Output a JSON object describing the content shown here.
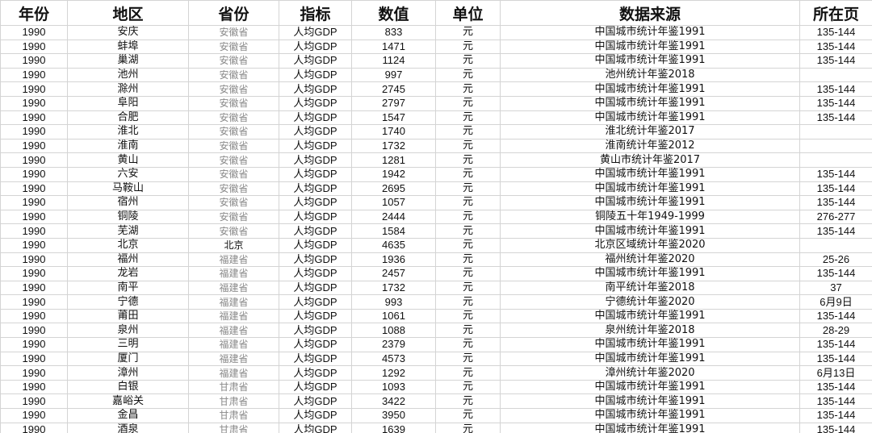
{
  "headers": [
    "年份",
    "地区",
    "省份",
    "指标",
    "数值",
    "单位",
    "数据来源",
    "所在页"
  ],
  "rows": [
    {
      "year": "1990",
      "region": "安庆",
      "province": "安徽省",
      "indicator": "人均GDP",
      "value": "833",
      "unit": "元",
      "source": "中国城市统计年鉴1991",
      "page": "135-144"
    },
    {
      "year": "1990",
      "region": "蚌埠",
      "province": "安徽省",
      "indicator": "人均GDP",
      "value": "1471",
      "unit": "元",
      "source": "中国城市统计年鉴1991",
      "page": "135-144"
    },
    {
      "year": "1990",
      "region": "巢湖",
      "province": "安徽省",
      "indicator": "人均GDP",
      "value": "1124",
      "unit": "元",
      "source": "中国城市统计年鉴1991",
      "page": "135-144"
    },
    {
      "year": "1990",
      "region": "池州",
      "province": "安徽省",
      "indicator": "人均GDP",
      "value": "997",
      "unit": "元",
      "source": "池州统计年鉴2018",
      "page": ""
    },
    {
      "year": "1990",
      "region": "滁州",
      "province": "安徽省",
      "indicator": "人均GDP",
      "value": "2745",
      "unit": "元",
      "source": "中国城市统计年鉴1991",
      "page": "135-144"
    },
    {
      "year": "1990",
      "region": "阜阳",
      "province": "安徽省",
      "indicator": "人均GDP",
      "value": "2797",
      "unit": "元",
      "source": "中国城市统计年鉴1991",
      "page": "135-144"
    },
    {
      "year": "1990",
      "region": "合肥",
      "province": "安徽省",
      "indicator": "人均GDP",
      "value": "1547",
      "unit": "元",
      "source": "中国城市统计年鉴1991",
      "page": "135-144"
    },
    {
      "year": "1990",
      "region": "淮北",
      "province": "安徽省",
      "indicator": "人均GDP",
      "value": "1740",
      "unit": "元",
      "source": "淮北统计年鉴2017",
      "page": ""
    },
    {
      "year": "1990",
      "region": "淮南",
      "province": "安徽省",
      "indicator": "人均GDP",
      "value": "1732",
      "unit": "元",
      "source": "淮南统计年鉴2012",
      "page": ""
    },
    {
      "year": "1990",
      "region": "黄山",
      "province": "安徽省",
      "indicator": "人均GDP",
      "value": "1281",
      "unit": "元",
      "source": "黄山市统计年鉴2017",
      "page": ""
    },
    {
      "year": "1990",
      "region": "六安",
      "province": "安徽省",
      "indicator": "人均GDP",
      "value": "1942",
      "unit": "元",
      "source": "中国城市统计年鉴1991",
      "page": "135-144"
    },
    {
      "year": "1990",
      "region": "马鞍山",
      "province": "安徽省",
      "indicator": "人均GDP",
      "value": "2695",
      "unit": "元",
      "source": "中国城市统计年鉴1991",
      "page": "135-144"
    },
    {
      "year": "1990",
      "region": "宿州",
      "province": "安徽省",
      "indicator": "人均GDP",
      "value": "1057",
      "unit": "元",
      "source": "中国城市统计年鉴1991",
      "page": "135-144"
    },
    {
      "year": "1990",
      "region": "铜陵",
      "province": "安徽省",
      "indicator": "人均GDP",
      "value": "2444",
      "unit": "元",
      "source": "铜陵五十年1949-1999",
      "page": "276-277"
    },
    {
      "year": "1990",
      "region": "芜湖",
      "province": "安徽省",
      "indicator": "人均GDP",
      "value": "1584",
      "unit": "元",
      "source": "中国城市统计年鉴1991",
      "page": "135-144"
    },
    {
      "year": "1990",
      "region": "北京",
      "province": "北京",
      "indicator": "人均GDP",
      "value": "4635",
      "unit": "元",
      "source": "北京区域统计年鉴2020",
      "page": ""
    },
    {
      "year": "1990",
      "region": "福州",
      "province": "福建省",
      "indicator": "人均GDP",
      "value": "1936",
      "unit": "元",
      "source": "福州统计年鉴2020",
      "page": "25-26"
    },
    {
      "year": "1990",
      "region": "龙岩",
      "province": "福建省",
      "indicator": "人均GDP",
      "value": "2457",
      "unit": "元",
      "source": "中国城市统计年鉴1991",
      "page": "135-144"
    },
    {
      "year": "1990",
      "region": "南平",
      "province": "福建省",
      "indicator": "人均GDP",
      "value": "1732",
      "unit": "元",
      "source": "南平统计年鉴2018",
      "page": "37"
    },
    {
      "year": "1990",
      "region": "宁德",
      "province": "福建省",
      "indicator": "人均GDP",
      "value": "993",
      "unit": "元",
      "source": "宁德统计年鉴2020",
      "page": "6月9日"
    },
    {
      "year": "1990",
      "region": "莆田",
      "province": "福建省",
      "indicator": "人均GDP",
      "value": "1061",
      "unit": "元",
      "source": "中国城市统计年鉴1991",
      "page": "135-144"
    },
    {
      "year": "1990",
      "region": "泉州",
      "province": "福建省",
      "indicator": "人均GDP",
      "value": "1088",
      "unit": "元",
      "source": "泉州统计年鉴2018",
      "page": "28-29"
    },
    {
      "year": "1990",
      "region": "三明",
      "province": "福建省",
      "indicator": "人均GDP",
      "value": "2379",
      "unit": "元",
      "source": "中国城市统计年鉴1991",
      "page": "135-144"
    },
    {
      "year": "1990",
      "region": "厦门",
      "province": "福建省",
      "indicator": "人均GDP",
      "value": "4573",
      "unit": "元",
      "source": "中国城市统计年鉴1991",
      "page": "135-144"
    },
    {
      "year": "1990",
      "region": "漳州",
      "province": "福建省",
      "indicator": "人均GDP",
      "value": "1292",
      "unit": "元",
      "source": "漳州统计年鉴2020",
      "page": "6月13日"
    },
    {
      "year": "1990",
      "region": "白银",
      "province": "甘肃省",
      "indicator": "人均GDP",
      "value": "1093",
      "unit": "元",
      "source": "中国城市统计年鉴1991",
      "page": "135-144"
    },
    {
      "year": "1990",
      "region": "嘉峪关",
      "province": "甘肃省",
      "indicator": "人均GDP",
      "value": "3422",
      "unit": "元",
      "source": "中国城市统计年鉴1991",
      "page": "135-144"
    },
    {
      "year": "1990",
      "region": "金昌",
      "province": "甘肃省",
      "indicator": "人均GDP",
      "value": "3950",
      "unit": "元",
      "source": "中国城市统计年鉴1991",
      "page": "135-144"
    },
    {
      "year": "1990",
      "region": "酒泉",
      "province": "甘肃省",
      "indicator": "人均GDP",
      "value": "1639",
      "unit": "元",
      "source": "中国城市统计年鉴1991",
      "page": "135-144"
    }
  ]
}
